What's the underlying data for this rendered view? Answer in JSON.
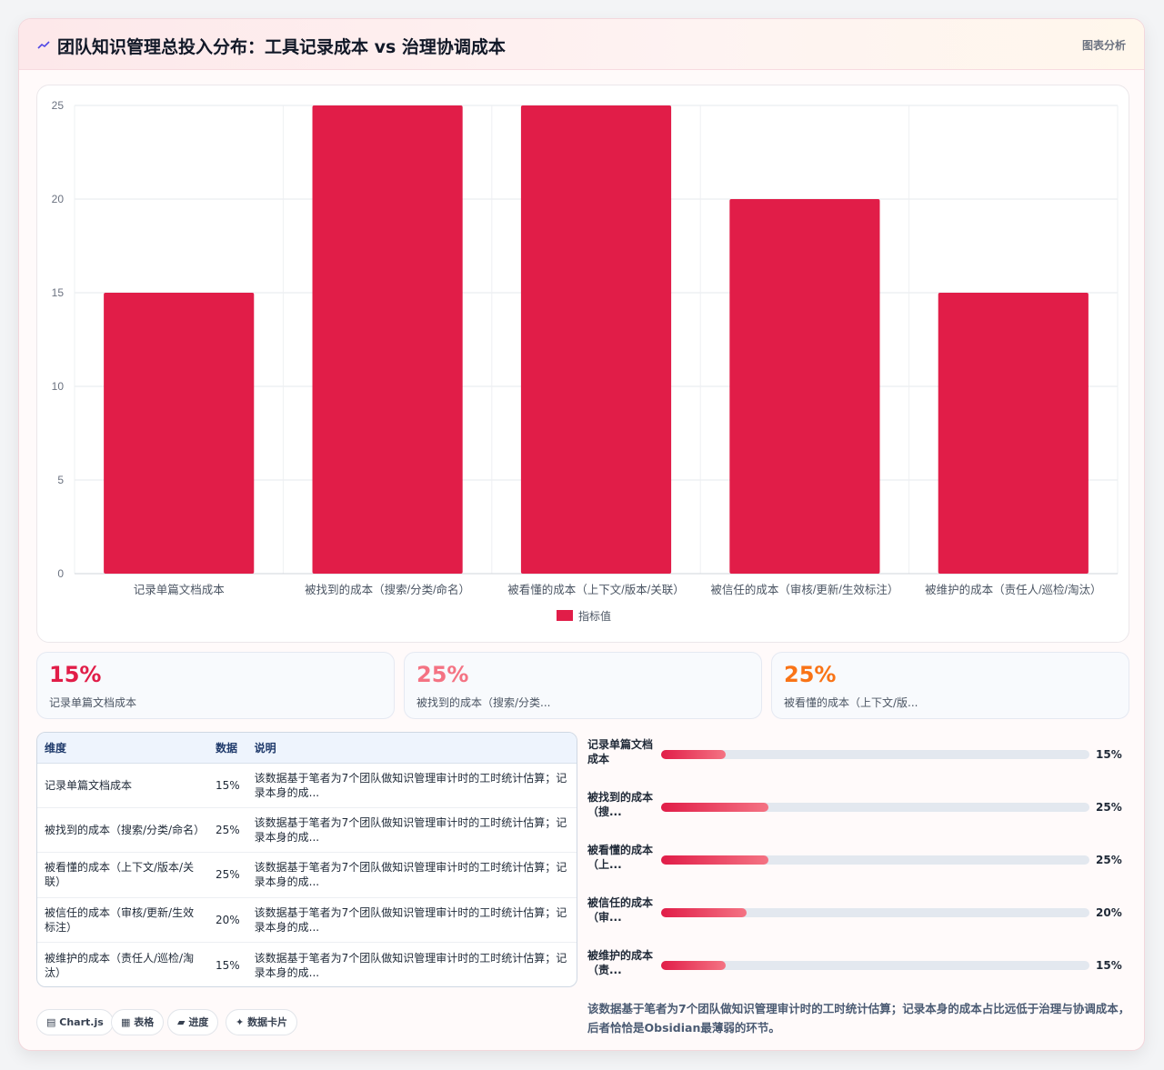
{
  "header": {
    "title": "团队知识管理总投入分布：工具记录成本 vs 治理协调成本",
    "analysis_label": "图表分析"
  },
  "chart_data": {
    "type": "bar",
    "categories": [
      "记录单篇文档成本",
      "被找到的成本（搜索/分类/命名）",
      "被看懂的成本（上下文/版本/关联）",
      "被信任的成本（审核/更新/生效标注）",
      "被维护的成本（责任人/巡检/淘汰）"
    ],
    "series": [
      {
        "name": "指标值",
        "values": [
          15,
          25,
          25,
          20,
          15
        ],
        "color": "#e11d48"
      }
    ],
    "ylim": [
      0,
      25
    ],
    "yticks": [
      0,
      5,
      10,
      15,
      20,
      25
    ],
    "grid": true,
    "legend": "bottom"
  },
  "kpis": [
    {
      "value": "15%",
      "label": "记录单篇文档成本",
      "color": "#e11d48"
    },
    {
      "value": "25%",
      "label": "被找到的成本（搜索/分类...",
      "color": "#f47383"
    },
    {
      "value": "25%",
      "label": "被看懂的成本（上下文/版...",
      "color": "#f97316"
    }
  ],
  "table": {
    "headers": [
      "维度",
      "数据",
      "说明"
    ],
    "rows": [
      {
        "dim": "记录单篇文档成本",
        "val": "15%",
        "note": "该数据基于笔者为7个团队做知识管理审计时的工时统计估算；记录本身的成..."
      },
      {
        "dim": "被找到的成本（搜索/分类/命名）",
        "val": "25%",
        "note": "该数据基于笔者为7个团队做知识管理审计时的工时统计估算；记录本身的成..."
      },
      {
        "dim": "被看懂的成本（上下文/版本/关联）",
        "val": "25%",
        "note": "该数据基于笔者为7个团队做知识管理审计时的工时统计估算；记录本身的成..."
      },
      {
        "dim": "被信任的成本（审核/更新/生效标注）",
        "val": "20%",
        "note": "该数据基于笔者为7个团队做知识管理审计时的工时统计估算；记录本身的成..."
      },
      {
        "dim": "被维护的成本（责任人/巡检/淘汰）",
        "val": "15%",
        "note": "该数据基于笔者为7个团队做知识管理审计时的工时统计估算；记录本身的成..."
      }
    ]
  },
  "progress": [
    {
      "label": "记录单篇文档成本",
      "value": "15%",
      "fraction": 0.15
    },
    {
      "label": "被找到的成本（搜...",
      "value": "25%",
      "fraction": 0.25
    },
    {
      "label": "被看懂的成本（上...",
      "value": "25%",
      "fraction": 0.25
    },
    {
      "label": "被信任的成本（审...",
      "value": "20%",
      "fraction": 0.2
    },
    {
      "label": "被维护的成本（责...",
      "value": "15%",
      "fraction": 0.15
    }
  ],
  "footnote": "该数据基于笔者为7个团队做知识管理审计时的工时统计估算；记录本身的成本占比远低于治理与协调成本，后者恰恰是Obsidian最薄弱的环节。",
  "tags": [
    {
      "icon": "▤",
      "label": "Chart.js"
    },
    {
      "icon": "▦",
      "label": "表格"
    },
    {
      "icon": "▰",
      "label": "进度"
    },
    {
      "icon": "✦",
      "label": "数据卡片"
    }
  ]
}
